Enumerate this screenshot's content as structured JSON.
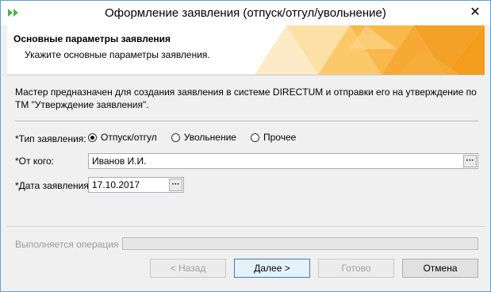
{
  "window": {
    "title": "Оформление заявления (отпуск/отгул/увольнение)",
    "close_symbol": "✕"
  },
  "header": {
    "title": "Основные параметры заявления",
    "subtitle": "Укажите основные параметры заявления."
  },
  "description": "Мастер предназначен для создания заявления в системе DIRECTUM и отправки его на утверждение по ТМ \"Утверждение заявления\".",
  "form": {
    "type_label": "*Тип заявления:",
    "type_options": [
      {
        "label": "Отпуск/отгул",
        "checked": true
      },
      {
        "label": "Увольнение",
        "checked": false
      },
      {
        "label": "Прочее",
        "checked": false
      }
    ],
    "from_label": "*От кого:",
    "from_value": "Иванов И.И.",
    "date_label": "*Дата заявления:",
    "date_value": "17.10.2017",
    "ellipsis": "···"
  },
  "status": {
    "label": "Выполняется операция",
    "progress": 0
  },
  "buttons": {
    "back": "< Назад",
    "next": "Далее >",
    "finish": "Готово",
    "cancel": "Отмена"
  },
  "colors": {
    "accent": "#3c7fb1",
    "header_decor": [
      "#f7a935",
      "#fbc96a",
      "#fde0a6",
      "#f39c1d"
    ]
  }
}
